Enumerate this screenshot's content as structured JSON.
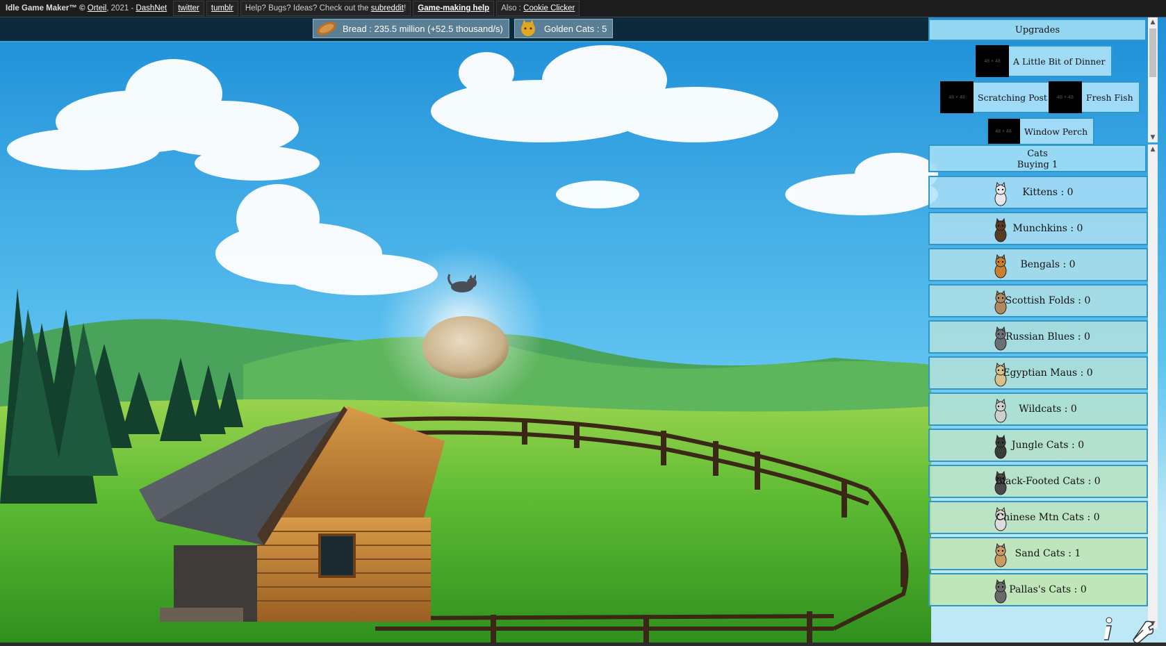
{
  "topbar": {
    "title": "Idle Game Maker™ © ",
    "author": "Orteil",
    "year_sep": ", 2021 - ",
    "company": "DashNet",
    "twitter": "twitter",
    "tumblr": "tumblr",
    "help_prefix": "Help? Bugs? Ideas? Check out the ",
    "subreddit": "subreddit",
    "help_suffix": "!",
    "game_help": "Game-making help",
    "also_prefix": "Also : ",
    "cookie_clicker": "Cookie Clicker"
  },
  "resources": {
    "bread": "Bread : 235.5 million (+52.5 thousand/s)",
    "golden_cats": "Golden Cats : 5"
  },
  "upgrades": {
    "header": "Upgrades",
    "placeholder": "48 × 48",
    "items": [
      {
        "name": "A Little Bit of Dinner"
      },
      {
        "name": "Scratching Post"
      },
      {
        "name": "Fresh Fish"
      },
      {
        "name": "Window Perch"
      }
    ]
  },
  "cats": {
    "header": "Cats",
    "buying": "Buying 1",
    "items": [
      {
        "label": "Kittens : 0",
        "color": "#e8e8e8"
      },
      {
        "label": "Munchkins : 0",
        "color": "#5a3a22"
      },
      {
        "label": "Bengals : 0",
        "color": "#c8802e"
      },
      {
        "label": "Scottish Folds : 0",
        "color": "#b08a5e"
      },
      {
        "label": "Russian Blues : 0",
        "color": "#6d6f78"
      },
      {
        "label": "Egyptian Maus : 0",
        "color": "#d8c08a"
      },
      {
        "label": "Wildcats : 0",
        "color": "#cfcfcf"
      },
      {
        "label": "Jungle Cats : 0",
        "color": "#3a3a3a"
      },
      {
        "label": "Black-Footed Cats : 0",
        "color": "#4a4a4a"
      },
      {
        "label": "Chinese Mtn Cats : 0",
        "color": "#dcdcdc"
      },
      {
        "label": "Sand Cats : 1",
        "color": "#c99a66"
      },
      {
        "label": "Pallas's Cats : 0",
        "color": "#6a6a6a"
      }
    ]
  },
  "colors": {
    "sky": "#2fa0e0",
    "grass": "#5cc03a",
    "panel_border": "#2f97c9",
    "statbar": "#0c2a3b"
  },
  "icons": {
    "info": "info-icon",
    "settings": "wrench-icon"
  }
}
